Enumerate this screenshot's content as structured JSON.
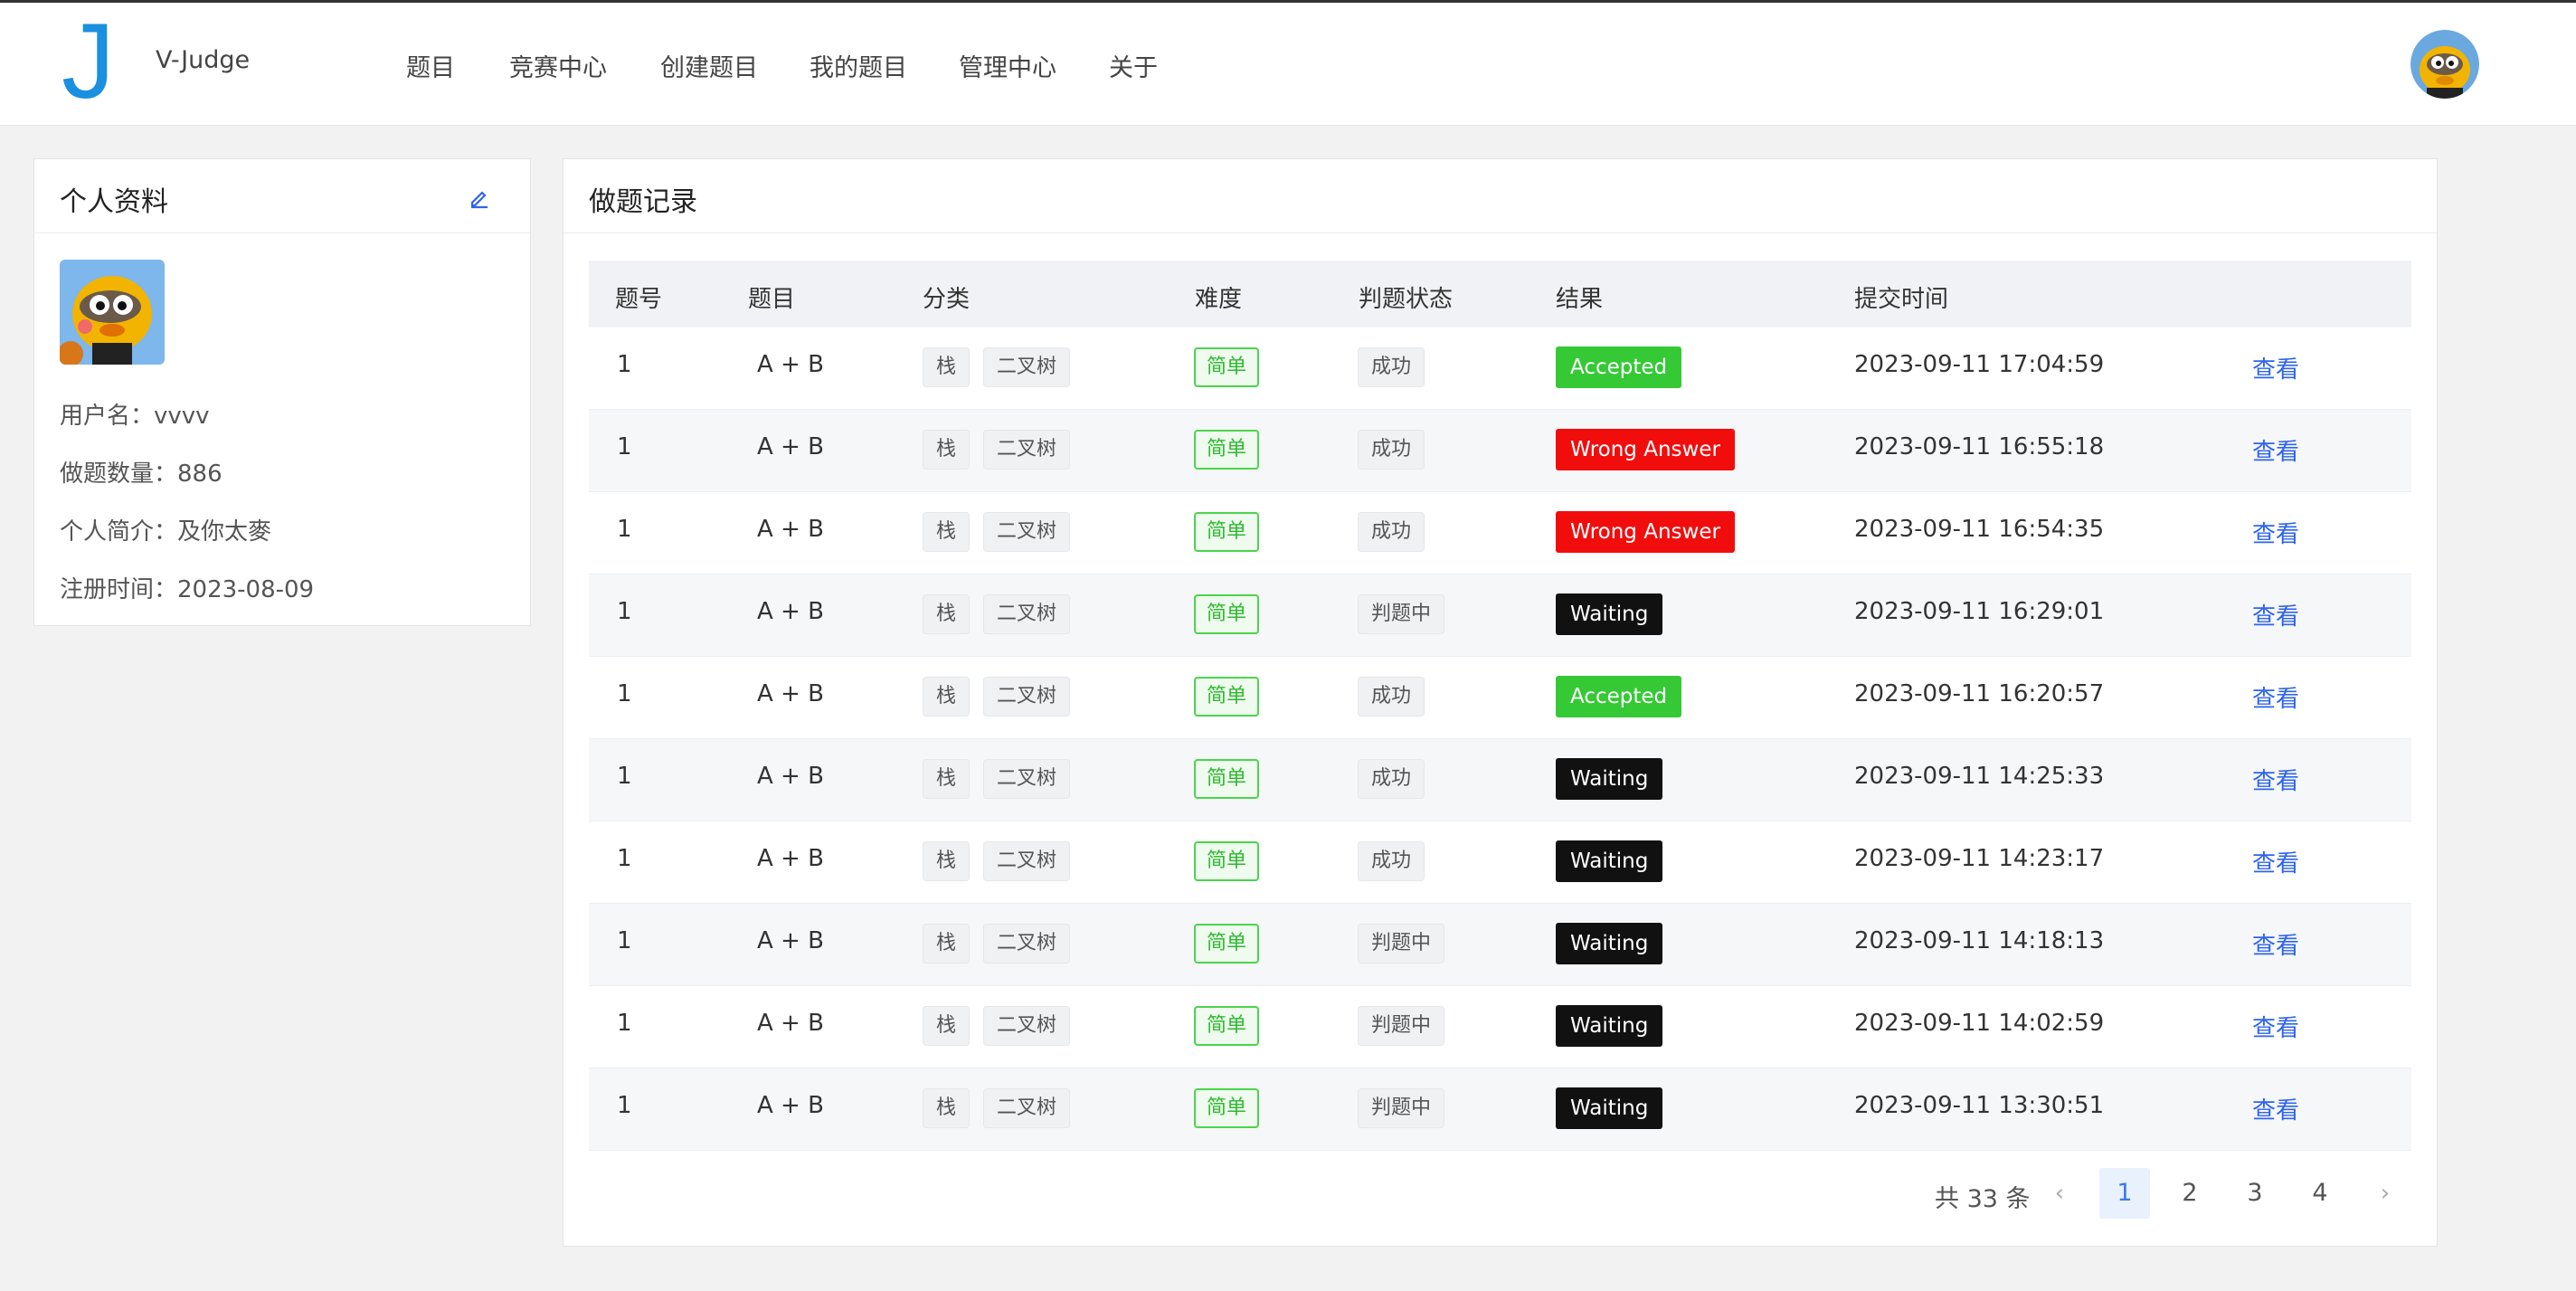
{
  "app": {
    "brand": "V-Judge",
    "logo_letter": "J"
  },
  "nav": [
    "题目",
    "竞赛中心",
    "创建题目",
    "我的题目",
    "管理中心",
    "关于"
  ],
  "profile": {
    "title": "个人资料",
    "username": "用户名：vvvv",
    "count": "做题数量：886",
    "bio": "个人简介：及你太麥",
    "registered": "注册时间：2023-08-09"
  },
  "records": {
    "title": "做题记录",
    "columns": [
      "题号",
      "题目",
      "分类",
      "难度",
      "判题状态",
      "结果",
      "提交时间"
    ],
    "view_label": "查看",
    "rows": [
      {
        "id": "1",
        "problem": "A + B",
        "tags": [
          "栈",
          "二叉树"
        ],
        "difficulty": "简单",
        "status": "成功",
        "result": "Accepted",
        "time": "2023-09-11 17:04:59"
      },
      {
        "id": "1",
        "problem": "A + B",
        "tags": [
          "栈",
          "二叉树"
        ],
        "difficulty": "简单",
        "status": "成功",
        "result": "Wrong Answer",
        "time": "2023-09-11 16:55:18"
      },
      {
        "id": "1",
        "problem": "A + B",
        "tags": [
          "栈",
          "二叉树"
        ],
        "difficulty": "简单",
        "status": "成功",
        "result": "Wrong Answer",
        "time": "2023-09-11 16:54:35"
      },
      {
        "id": "1",
        "problem": "A + B",
        "tags": [
          "栈",
          "二叉树"
        ],
        "difficulty": "简单",
        "status": "判题中",
        "result": "Waiting",
        "time": "2023-09-11 16:29:01"
      },
      {
        "id": "1",
        "problem": "A + B",
        "tags": [
          "栈",
          "二叉树"
        ],
        "difficulty": "简单",
        "status": "成功",
        "result": "Accepted",
        "time": "2023-09-11 16:20:57"
      },
      {
        "id": "1",
        "problem": "A + B",
        "tags": [
          "栈",
          "二叉树"
        ],
        "difficulty": "简单",
        "status": "成功",
        "result": "Waiting",
        "time": "2023-09-11 14:25:33"
      },
      {
        "id": "1",
        "problem": "A + B",
        "tags": [
          "栈",
          "二叉树"
        ],
        "difficulty": "简单",
        "status": "成功",
        "result": "Waiting",
        "time": "2023-09-11 14:23:17"
      },
      {
        "id": "1",
        "problem": "A + B",
        "tags": [
          "栈",
          "二叉树"
        ],
        "difficulty": "简单",
        "status": "判题中",
        "result": "Waiting",
        "time": "2023-09-11 14:18:13"
      },
      {
        "id": "1",
        "problem": "A + B",
        "tags": [
          "栈",
          "二叉树"
        ],
        "difficulty": "简单",
        "status": "判题中",
        "result": "Waiting",
        "time": "2023-09-11 14:02:59"
      },
      {
        "id": "1",
        "problem": "A + B",
        "tags": [
          "栈",
          "二叉树"
        ],
        "difficulty": "简单",
        "status": "判题中",
        "result": "Waiting",
        "time": "2023-09-11 13:30:51"
      }
    ]
  },
  "pagination": {
    "total": "共 33 条",
    "pages": [
      "1",
      "2",
      "3",
      "4"
    ],
    "current": "1"
  },
  "colors": {
    "accepted": "#35c935",
    "wrong": "#f20d0d",
    "waiting": "#111111",
    "link": "#2e64ec",
    "brand": "#1b8fe0"
  },
  "icons": {
    "edit": "edit-icon",
    "prev": "chevron-left-icon",
    "next": "chevron-right-icon"
  }
}
